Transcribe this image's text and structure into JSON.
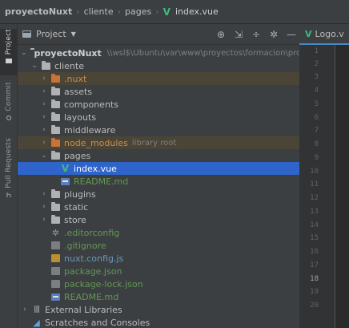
{
  "breadcrumb": {
    "items": [
      "proyectoNuxt",
      "cliente",
      "pages",
      "index.vue"
    ]
  },
  "toolstrip": {
    "tabs": [
      "Project",
      "Commit",
      "Pull Requests"
    ]
  },
  "panel": {
    "title": "Project",
    "tools": [
      "locate-icon",
      "expand-all-icon",
      "collapse-all-icon",
      "gear-icon",
      "hide-icon"
    ]
  },
  "tree": {
    "root": {
      "label": "proyectoNuxt",
      "path": "\\\\wsl$\\Ubuntu\\var\\www\\proyectos\\formacion\\proyectoNuxt"
    },
    "cliente": "cliente",
    "nuxt": ".nuxt",
    "assets": "assets",
    "components": "components",
    "layouts": "layouts",
    "middleware": "middleware",
    "node_modules": {
      "label": "node_modules",
      "hint": "library root"
    },
    "pages": "pages",
    "index_vue": "index.vue",
    "readme_pages": "README.md",
    "plugins": "plugins",
    "static": "static",
    "store": "store",
    "editorconfig": ".editorconfig",
    "gitignore": ".gitignore",
    "nuxt_config": "nuxt.config.js",
    "package_json": "package.json",
    "package_lock": "package-lock.json",
    "readme_root": "README.md",
    "external_libraries": "External Libraries",
    "scratches": "Scratches and Consoles"
  },
  "editor": {
    "tab_label": "Logo.v",
    "line_numbers": [
      "1",
      "2",
      "3",
      "4",
      "5",
      "6",
      "7",
      "8",
      "9",
      "10",
      "11",
      "12",
      "13",
      "14",
      "15",
      "16",
      "17",
      "18",
      "19",
      "20"
    ],
    "current_line": "18"
  },
  "colors": {
    "vue_green": "#41b883",
    "selection": "#2f65ca",
    "excluded_bg": "#4a4536",
    "git_added": "#629755",
    "git_modified": "#6897bb"
  }
}
